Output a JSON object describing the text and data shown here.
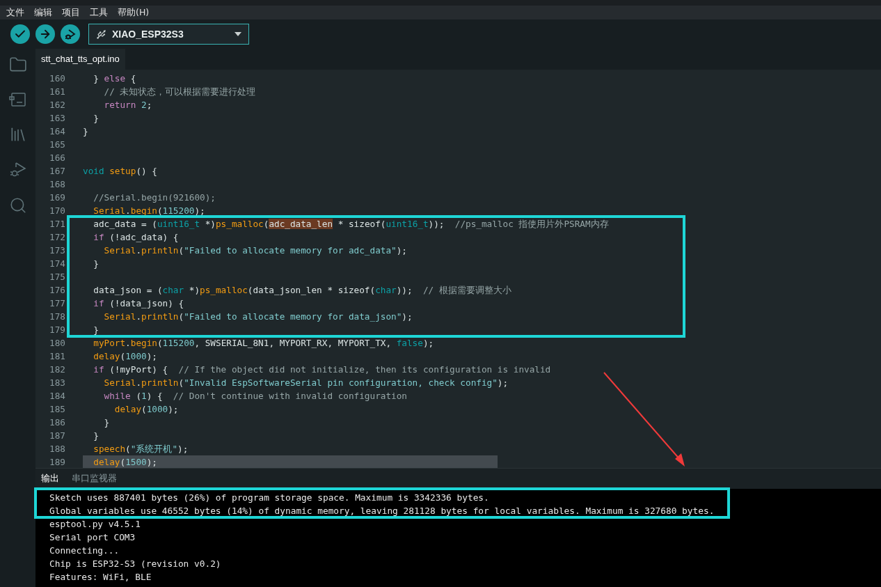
{
  "menu": [
    "文件",
    "编辑",
    "项目",
    "工具",
    "帮助(H)"
  ],
  "toolbar": {
    "board": "XIAO_ESP32S3"
  },
  "tabs": [
    {
      "label": "stt_chat_tts_opt.ino",
      "selected": true
    }
  ],
  "code_lines": [
    {
      "number": "160",
      "current": false,
      "tokens": [
        {
          "kind": "plain",
          "text": "  } "
        },
        {
          "kind": "keyword",
          "text": "else"
        },
        {
          "kind": "plain",
          "text": " {"
        }
      ]
    },
    {
      "number": "161",
      "current": false,
      "tokens": [
        {
          "kind": "comment",
          "text": "    // 未知状态，可以根据需要进行处理"
        }
      ]
    },
    {
      "number": "162",
      "current": false,
      "tokens": [
        {
          "kind": "keyword",
          "text": "    return"
        },
        {
          "kind": "number",
          "text": " 2"
        },
        {
          "kind": "plain",
          "text": ";"
        }
      ]
    },
    {
      "number": "163",
      "current": false,
      "tokens": [
        {
          "kind": "plain",
          "text": "  }"
        }
      ]
    },
    {
      "number": "164",
      "current": false,
      "tokens": [
        {
          "kind": "plain",
          "text": "}"
        }
      ]
    },
    {
      "number": "165"
    },
    {
      "number": "166"
    },
    {
      "number": "167",
      "current": false,
      "tokens": [
        {
          "kind": "type",
          "text": "void"
        },
        {
          "kind": "function",
          "text": " setup"
        },
        {
          "kind": "plain",
          "text": "() {"
        }
      ]
    },
    {
      "number": "168"
    },
    {
      "number": "169",
      "current": false,
      "tokens": [
        {
          "kind": "comment",
          "text": "  //Serial.begin(921600);"
        }
      ]
    },
    {
      "number": "170",
      "current": false,
      "tokens": [
        {
          "kind": "function",
          "text": "  Serial"
        },
        {
          "kind": "plain",
          "text": "."
        },
        {
          "kind": "function",
          "text": "begin"
        },
        {
          "kind": "plain",
          "text": "("
        },
        {
          "kind": "number",
          "text": "115200"
        },
        {
          "kind": "plain",
          "text": ");"
        }
      ]
    },
    {
      "number": "171",
      "current": false,
      "tokens": [
        {
          "kind": "plain",
          "text": "  adc_data = ("
        },
        {
          "kind": "type",
          "text": "uint16_t"
        },
        {
          "kind": "plain",
          "text": " *)"
        },
        {
          "kind": "function",
          "text": "ps_malloc"
        },
        {
          "kind": "plain",
          "text": "("
        },
        {
          "kind": "match",
          "text": "adc_data_len"
        },
        {
          "kind": "plain",
          "text": " * sizeof("
        },
        {
          "kind": "type",
          "text": "uint16_t"
        },
        {
          "kind": "plain",
          "text": "));"
        },
        {
          "kind": "comment",
          "text": "  //ps_malloc 指使用片外PSRAM内存"
        }
      ]
    },
    {
      "number": "172",
      "current": false,
      "tokens": [
        {
          "kind": "keyword",
          "text": "  if"
        },
        {
          "kind": "plain",
          "text": " (!adc_data) {"
        }
      ]
    },
    {
      "number": "173",
      "current": false,
      "tokens": [
        {
          "kind": "function",
          "text": "    Serial"
        },
        {
          "kind": "plain",
          "text": "."
        },
        {
          "kind": "function",
          "text": "println"
        },
        {
          "kind": "plain",
          "text": "("
        },
        {
          "kind": "string",
          "text": "\"Failed to allocate memory for adc_data\""
        },
        {
          "kind": "plain",
          "text": ");"
        }
      ]
    },
    {
      "number": "174",
      "current": false,
      "tokens": [
        {
          "kind": "plain",
          "text": "  }"
        }
      ]
    },
    {
      "number": "175"
    },
    {
      "number": "176",
      "current": false,
      "tokens": [
        {
          "kind": "plain",
          "text": "  data_json = ("
        },
        {
          "kind": "type",
          "text": "char"
        },
        {
          "kind": "plain",
          "text": " *)"
        },
        {
          "kind": "function",
          "text": "ps_malloc"
        },
        {
          "kind": "plain",
          "text": "(data_json_len * sizeof("
        },
        {
          "kind": "type",
          "text": "char"
        },
        {
          "kind": "plain",
          "text": "));"
        },
        {
          "kind": "comment",
          "text": "  // 根据需要调整大小"
        }
      ]
    },
    {
      "number": "177",
      "current": false,
      "tokens": [
        {
          "kind": "keyword",
          "text": "  if"
        },
        {
          "kind": "plain",
          "text": " (!data_json) {"
        }
      ]
    },
    {
      "number": "178",
      "current": false,
      "tokens": [
        {
          "kind": "function",
          "text": "    Serial"
        },
        {
          "kind": "plain",
          "text": "."
        },
        {
          "kind": "function",
          "text": "println"
        },
        {
          "kind": "plain",
          "text": "("
        },
        {
          "kind": "string",
          "text": "\"Failed to allocate memory for data_json\""
        },
        {
          "kind": "plain",
          "text": ");"
        }
      ]
    },
    {
      "number": "179",
      "current": false,
      "tokens": [
        {
          "kind": "plain",
          "text": "  }"
        }
      ]
    },
    {
      "number": "180",
      "current": false,
      "tokens": [
        {
          "kind": "function",
          "text": "  myPort"
        },
        {
          "kind": "plain",
          "text": "."
        },
        {
          "kind": "function",
          "text": "begin"
        },
        {
          "kind": "plain",
          "text": "("
        },
        {
          "kind": "number",
          "text": "115200"
        },
        {
          "kind": "plain",
          "text": ", SWSERIAL_8N1, MYPORT_RX, MYPORT_TX, "
        },
        {
          "kind": "type",
          "text": "false"
        },
        {
          "kind": "plain",
          "text": ");"
        }
      ]
    },
    {
      "number": "181",
      "current": false,
      "tokens": [
        {
          "kind": "function",
          "text": "  delay"
        },
        {
          "kind": "plain",
          "text": "("
        },
        {
          "kind": "number",
          "text": "1000"
        },
        {
          "kind": "plain",
          "text": ");"
        }
      ]
    },
    {
      "number": "182",
      "current": false,
      "tokens": [
        {
          "kind": "keyword",
          "text": "  if"
        },
        {
          "kind": "plain",
          "text": " (!myPort) {"
        },
        {
          "kind": "comment",
          "text": "  // If the object did not initialize, then its configuration is invalid"
        }
      ]
    },
    {
      "number": "183",
      "current": false,
      "tokens": [
        {
          "kind": "function",
          "text": "    Serial"
        },
        {
          "kind": "plain",
          "text": "."
        },
        {
          "kind": "function",
          "text": "println"
        },
        {
          "kind": "plain",
          "text": "("
        },
        {
          "kind": "string",
          "text": "\"Invalid EspSoftwareSerial pin configuration, check config\""
        },
        {
          "kind": "plain",
          "text": ");"
        }
      ]
    },
    {
      "number": "184",
      "current": false,
      "tokens": [
        {
          "kind": "keyword",
          "text": "    while"
        },
        {
          "kind": "plain",
          "text": " ("
        },
        {
          "kind": "number",
          "text": "1"
        },
        {
          "kind": "plain",
          "text": ") {"
        },
        {
          "kind": "comment",
          "text": "  // Don't continue with invalid configuration"
        }
      ]
    },
    {
      "number": "185",
      "current": false,
      "tokens": [
        {
          "kind": "function",
          "text": "      delay"
        },
        {
          "kind": "plain",
          "text": "("
        },
        {
          "kind": "number",
          "text": "1000"
        },
        {
          "kind": "plain",
          "text": ");"
        }
      ]
    },
    {
      "number": "186",
      "current": false,
      "tokens": [
        {
          "kind": "plain",
          "text": "    }"
        }
      ]
    },
    {
      "number": "187",
      "current": false,
      "tokens": [
        {
          "kind": "plain",
          "text": "  }"
        }
      ]
    },
    {
      "number": "188",
      "current": false,
      "tokens": [
        {
          "kind": "function",
          "text": "  speech"
        },
        {
          "kind": "plain",
          "text": "("
        },
        {
          "kind": "string",
          "text": "\"系统开机\""
        },
        {
          "kind": "plain",
          "text": ");"
        }
      ]
    },
    {
      "number": "189",
      "current": true,
      "tokens": [
        {
          "kind": "function",
          "text": "  delay"
        },
        {
          "kind": "plain",
          "text": "("
        },
        {
          "kind": "number",
          "text": "1500"
        },
        {
          "kind": "plain",
          "text": ");"
        }
      ]
    }
  ],
  "output_tabs": [
    {
      "label": "输出",
      "selected": true
    },
    {
      "label": "串口监视器",
      "selected": false
    }
  ],
  "output_lines": [
    "Sketch uses 887401 bytes (26%) of program storage space. Maximum is 3342336 bytes.",
    "Global variables use 46552 bytes (14%) of dynamic memory, leaving 281128 bytes for local variables. Maximum is 327680 bytes.",
    "esptool.py v4.5.1",
    "Serial port COM3",
    "Connecting...",
    "Chip is ESP32-S3 (revision v0.2)",
    "Features: WiFi, BLE"
  ]
}
